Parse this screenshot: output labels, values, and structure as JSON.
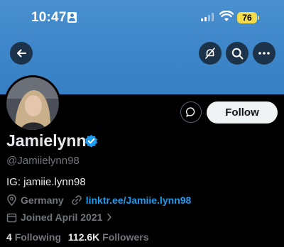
{
  "status_bar": {
    "time": "10:47",
    "battery": "76"
  },
  "profile": {
    "display_name": "Jamielynn",
    "handle": "@Jamiielynn98",
    "bio": "IG: jamiie.lynn98",
    "location": "Germany",
    "website": "linktr.ee/Jamiie.lynn98",
    "joined": "Joined April 2021",
    "following_count": "4",
    "following_label": "Following",
    "followers_count": "112.6K",
    "followers_label": "Followers"
  },
  "actions": {
    "follow_label": "Follow"
  },
  "colors": {
    "banner": "#3d86c9",
    "verified": "#1d9bf0",
    "link": "#1d9bf0",
    "follow_button_bg": "#eff3f4"
  },
  "icons": [
    "person-icon",
    "signal-icon",
    "wifi-icon",
    "battery-icon",
    "back-arrow-icon",
    "no-bell-icon",
    "search-icon",
    "more-icon",
    "message-icon",
    "verified-badge-icon",
    "location-icon",
    "link-icon",
    "calendar-icon",
    "chevron-right-icon"
  ]
}
